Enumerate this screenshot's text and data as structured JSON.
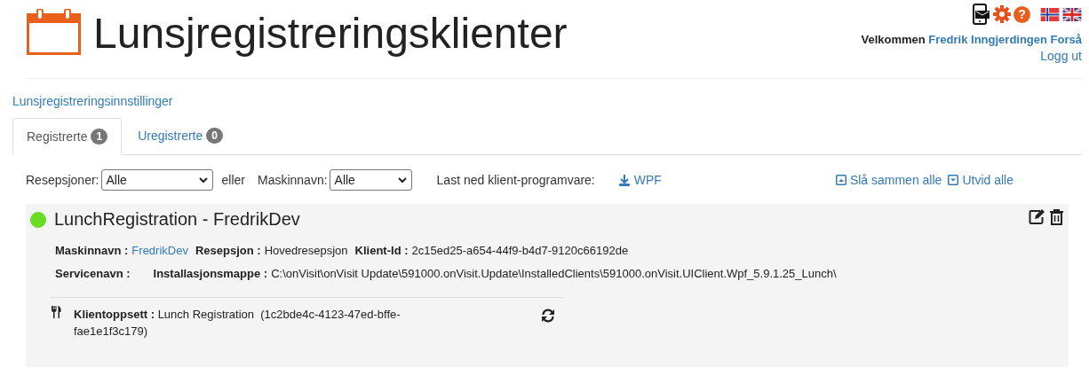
{
  "header": {
    "title": "Lunsjregistreringsklienter",
    "help_glyph": "?",
    "welcome": "Velkommen",
    "user_name": "Fredrik Inngjerdingen Forså",
    "logout": "Logg ut"
  },
  "settings_link": "Lunsjregistreringsinnstillinger",
  "tabs": [
    {
      "label": "Registrerte",
      "count": "1",
      "selected": true
    },
    {
      "label": "Uregistrerte",
      "count": "0",
      "selected": false
    }
  ],
  "filters": {
    "reception_label": "Resepsjoner:",
    "reception_value": "Alle",
    "separator": "eller",
    "machine_label": "Maskinnavn:",
    "machine_value": "Alle",
    "download_label": "Last ned klient-programvare:",
    "download_link": "WPF",
    "collapse_all": "Slå sammen alle",
    "expand_all": "Utvid alle"
  },
  "clients": [
    {
      "title": "LunchRegistration - FredrikDev",
      "color": "#66dd22",
      "rows": [
        [
          {
            "label": "Maskinnavn :",
            "value": "FredrikDev",
            "kind": "link"
          },
          {
            "label": "Resepsjon :",
            "value": "Hovedresepsjon",
            "kind": "text"
          },
          {
            "label": "Klient-Id :",
            "value": "2c15ed25-a654-44f9-b4d7-9120c66192de",
            "kind": "text"
          }
        ],
        [
          {
            "label": "Servicenavn :",
            "kind": "empty"
          },
          {
            "label": "Installasjonsmappe :",
            "value": "C:\\onVisit\\onVisit Update\\591000.onVisit.Update\\InstalledClients\\591000.onVisit.UIClient.Wpf_5.9.1.25_Lunch\\",
            "kind": "text"
          }
        ]
      ],
      "setup": {
        "label": "Klientoppsett :",
        "value": "Lunch Registration  (1c2bde4c-4123-47ed-bffe-fae1e1f3c179)"
      }
    }
  ]
}
